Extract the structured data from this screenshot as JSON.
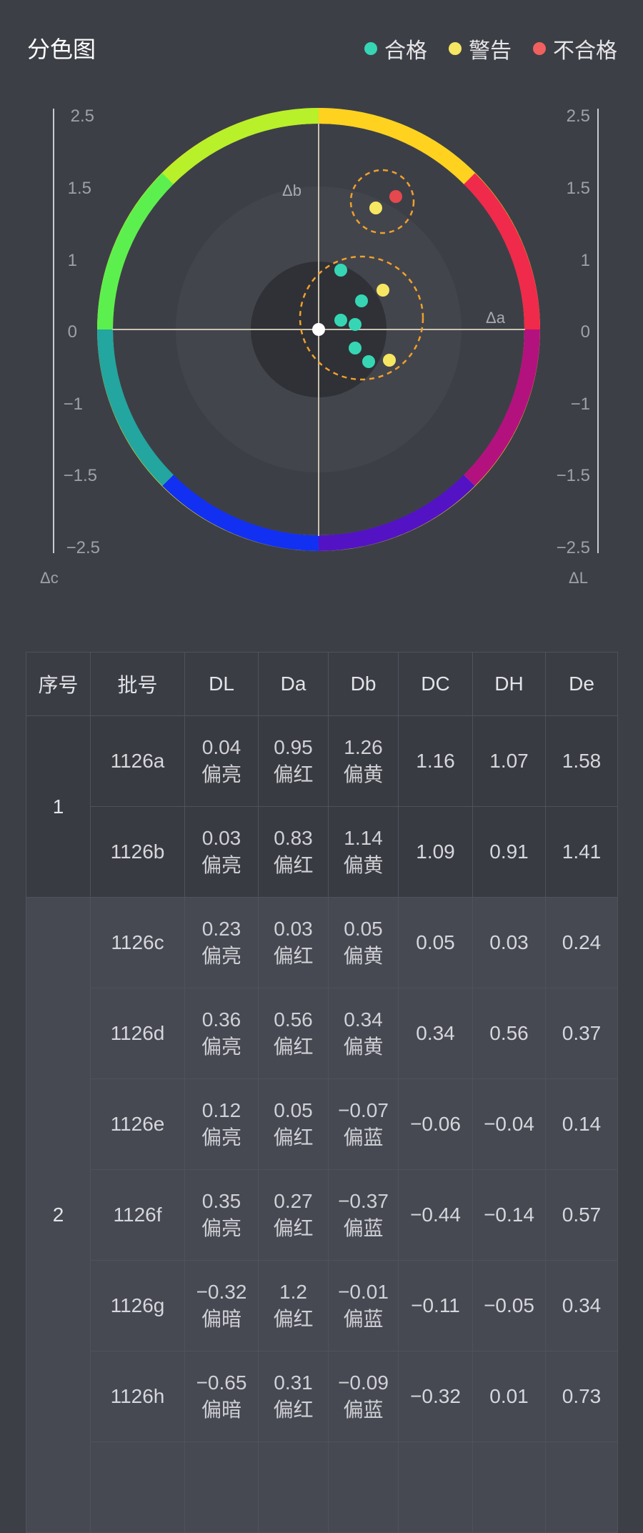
{
  "header": {
    "title": "分色图",
    "legend": [
      {
        "label": "合格",
        "color": "#36d6b4"
      },
      {
        "label": "警告",
        "color": "#f6e763"
      },
      {
        "label": "不合格",
        "color": "#f0605e"
      }
    ]
  },
  "chart": {
    "axis_label_b": "Δb",
    "axis_label_a": "Δa",
    "axis_label_c": "Δc",
    "axis_label_L": "ΔL",
    "left_ticks": [
      "2.5",
      "1.5",
      "1",
      "0",
      "−1",
      "−1.5",
      "−2.5"
    ],
    "right_ticks": [
      "2.5",
      "1.5",
      "1",
      "0",
      "−1",
      "−1.5",
      "−2.5"
    ],
    "points": [
      {
        "status": "pass",
        "color": "#36d6b4"
      },
      {
        "status": "pass",
        "color": "#36d6b4"
      },
      {
        "status": "pass",
        "color": "#36d6b4"
      },
      {
        "status": "pass",
        "color": "#36d6b4"
      },
      {
        "status": "pass",
        "color": "#36d6b4"
      },
      {
        "status": "pass",
        "color": "#36d6b4"
      },
      {
        "status": "warn",
        "color": "#f6e763"
      },
      {
        "status": "warn",
        "color": "#f6e763"
      },
      {
        "status": "warn",
        "color": "#f6e763"
      },
      {
        "status": "fail",
        "color": "#e5484d"
      }
    ]
  },
  "table": {
    "headers": [
      "序号",
      "批号",
      "DL",
      "Da",
      "Db",
      "DC",
      "DH",
      "De"
    ],
    "rows": [
      {
        "group": "1",
        "batch": "1126a",
        "dl": [
          "0.04",
          "偏亮"
        ],
        "da": [
          "0.95",
          "偏红"
        ],
        "db": [
          "1.26",
          "偏黄"
        ],
        "dc": "1.16",
        "dh": "1.07",
        "de": "1.58"
      },
      {
        "group": "1",
        "batch": "1126b",
        "dl": [
          "0.03",
          "偏亮"
        ],
        "da": [
          "0.83",
          "偏红"
        ],
        "db": [
          "1.14",
          "偏黄"
        ],
        "dc": "1.09",
        "dh": "0.91",
        "de": "1.41"
      },
      {
        "group": "2",
        "batch": "1126c",
        "dl": [
          "0.23",
          "偏亮"
        ],
        "da": [
          "0.03",
          "偏红"
        ],
        "db": [
          "0.05",
          "偏黄"
        ],
        "dc": "0.05",
        "dh": "0.03",
        "de": "0.24"
      },
      {
        "group": "2",
        "batch": "1126d",
        "dl": [
          "0.36",
          "偏亮"
        ],
        "da": [
          "0.56",
          "偏红"
        ],
        "db": [
          "0.34",
          "偏黄"
        ],
        "dc": "0.34",
        "dh": "0.56",
        "de": "0.37"
      },
      {
        "group": "2",
        "batch": "1126e",
        "dl": [
          "0.12",
          "偏亮"
        ],
        "da": [
          "0.05",
          "偏红"
        ],
        "db": [
          "−0.07",
          "偏蓝"
        ],
        "dc": "−0.06",
        "dh": "−0.04",
        "de": "0.14"
      },
      {
        "group": "2",
        "batch": "1126f",
        "dl": [
          "0.35",
          "偏亮"
        ],
        "da": [
          "0.27",
          "偏红"
        ],
        "db": [
          "−0.37",
          "偏蓝"
        ],
        "dc": "−0.44",
        "dh": "−0.14",
        "de": "0.57"
      },
      {
        "group": "2",
        "batch": "1126g",
        "dl": [
          "−0.32",
          "偏暗"
        ],
        "da": [
          "1.2",
          "偏红"
        ],
        "db": [
          "−0.01",
          "偏蓝"
        ],
        "dc": "−0.11",
        "dh": "−0.05",
        "de": "0.34"
      },
      {
        "group": "2",
        "batch": "1126h",
        "dl": [
          "−0.65",
          "偏暗"
        ],
        "da": [
          "0.31",
          "偏红"
        ],
        "db": [
          "−0.09",
          "偏蓝"
        ],
        "dc": "−0.32",
        "dh": "0.01",
        "de": "0.73"
      }
    ]
  }
}
